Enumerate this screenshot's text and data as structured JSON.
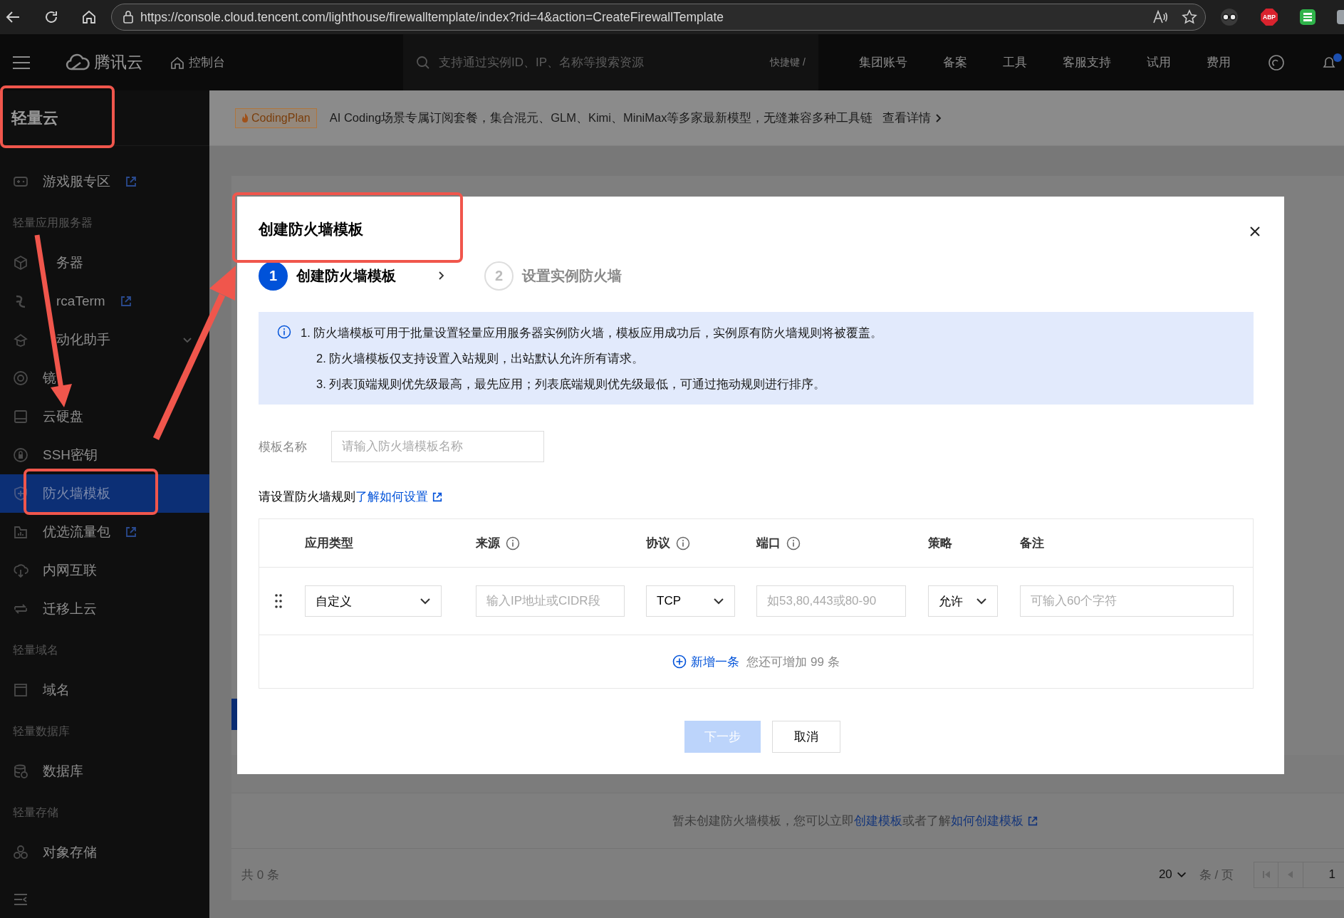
{
  "browser": {
    "url": "https://console.cloud.tencent.com/lighthouse/firewalltemplate/index?rid=4&action=CreateFirewallTemplate",
    "extension_badge": "ABP"
  },
  "topnav": {
    "brand": "腾讯云",
    "console": "控制台",
    "search": {
      "placeholder": "支持通过实例ID、IP、名称等搜索资源"
    },
    "shortcut": "快捷键 /",
    "links": [
      "集团账号",
      "备案",
      "工具",
      "客服支持",
      "试用",
      "费用"
    ]
  },
  "sidebar": {
    "title": "轻量云",
    "items": [
      {
        "kind": "item",
        "label": "游戏服专区",
        "external": true,
        "selected": false,
        "covered": false
      },
      {
        "kind": "group",
        "label": "轻量应用服务器"
      },
      {
        "kind": "item",
        "label": "务器",
        "external": false,
        "selected": false,
        "covered": true
      },
      {
        "kind": "item",
        "label": "rcaTerm",
        "external": true,
        "selected": false,
        "covered": true
      },
      {
        "kind": "item",
        "label": "动化助手",
        "external": false,
        "selected": false,
        "covered": true,
        "expanded": false
      },
      {
        "kind": "item",
        "label": "镜",
        "external": false,
        "selected": false,
        "covered": false
      },
      {
        "kind": "item",
        "label": "云硬盘",
        "external": false,
        "selected": false,
        "covered": false
      },
      {
        "kind": "item",
        "label": "SSH密钥",
        "external": false,
        "selected": false,
        "covered": false
      },
      {
        "kind": "item",
        "label": "防火墙模板",
        "external": false,
        "selected": true,
        "covered": false
      },
      {
        "kind": "item",
        "label": "优选流量包",
        "external": true,
        "selected": false,
        "covered": false
      },
      {
        "kind": "item",
        "label": "内网互联",
        "external": false,
        "selected": false,
        "covered": false
      },
      {
        "kind": "item",
        "label": "迁移上云",
        "external": false,
        "selected": false,
        "covered": false
      },
      {
        "kind": "group",
        "label": "轻量域名"
      },
      {
        "kind": "item",
        "label": "域名",
        "external": false,
        "selected": false,
        "covered": false
      },
      {
        "kind": "group",
        "label": "轻量数据库"
      },
      {
        "kind": "item",
        "label": "数据库",
        "external": false,
        "selected": false,
        "covered": false
      },
      {
        "kind": "group",
        "label": "轻量存储"
      },
      {
        "kind": "item",
        "label": "对象存储",
        "external": false,
        "selected": false,
        "covered": false
      }
    ]
  },
  "banner": {
    "tag": "CodingPlan",
    "text": "AI Coding场景专属订阅套餐，集合混元、GLM、Kimi、MiniMax等多家最新模型，无缝兼容多种工具链",
    "link": "查看详情"
  },
  "list": {
    "empty": {
      "before": "暂未创建防火墙模板，您可以立即",
      "link": "创建模板",
      "middle": "或者了解",
      "link2": "如何创建模板"
    },
    "total": "共 0 条",
    "page_size": "20",
    "per_page": "条 / 页",
    "page": "1"
  },
  "modal": {
    "title": "创建防火墙模板",
    "steps": [
      {
        "number": "1",
        "label": "创建防火墙模板",
        "selected": true
      },
      {
        "number": "2",
        "label": "设置实例防火墙",
        "selected": false
      }
    ],
    "notice": [
      "1. 防火墙模板可用于批量设置轻量应用服务器实例防火墙，模板应用成功后，实例原有防火墙规则将被覆盖。",
      "2. 防火墙模板仅支持设置入站规则，出站默认允许所有请求。",
      "3. 列表顶端规则优先级最高，最先应用；列表底端规则优先级最低，可通过拖动规则进行排序。"
    ],
    "name_field": {
      "label": "模板名称",
      "placeholder": "请输入防火墙模板名称"
    },
    "rules_hint": {
      "text": "请设置防火墙规则",
      "link": "了解如何设置"
    },
    "table": {
      "columns": [
        {
          "label": "应用类型",
          "info": false
        },
        {
          "label": "来源",
          "info": true
        },
        {
          "label": "协议",
          "info": true
        },
        {
          "label": "端口",
          "info": true
        },
        {
          "label": "策略",
          "info": false
        },
        {
          "label": "备注",
          "info": false
        }
      ],
      "rows": [
        {
          "cells": [
            {
              "kind": "select",
              "value": "自定义"
            },
            {
              "kind": "input",
              "placeholder": "输入IP地址或CIDR段"
            },
            {
              "kind": "select",
              "value": "TCP"
            },
            {
              "kind": "input",
              "placeholder": "如53,80,443或80-90"
            },
            {
              "kind": "select",
              "value": "允许"
            },
            {
              "kind": "input",
              "placeholder": "可输入60个字符"
            }
          ]
        }
      ],
      "add": {
        "link": "新增一条",
        "note": "您还可增加 99 条"
      }
    },
    "buttons": [
      {
        "label": "下一步",
        "kind": "primary",
        "disabled": true
      },
      {
        "label": "取消",
        "kind": "default",
        "disabled": false
      }
    ]
  }
}
